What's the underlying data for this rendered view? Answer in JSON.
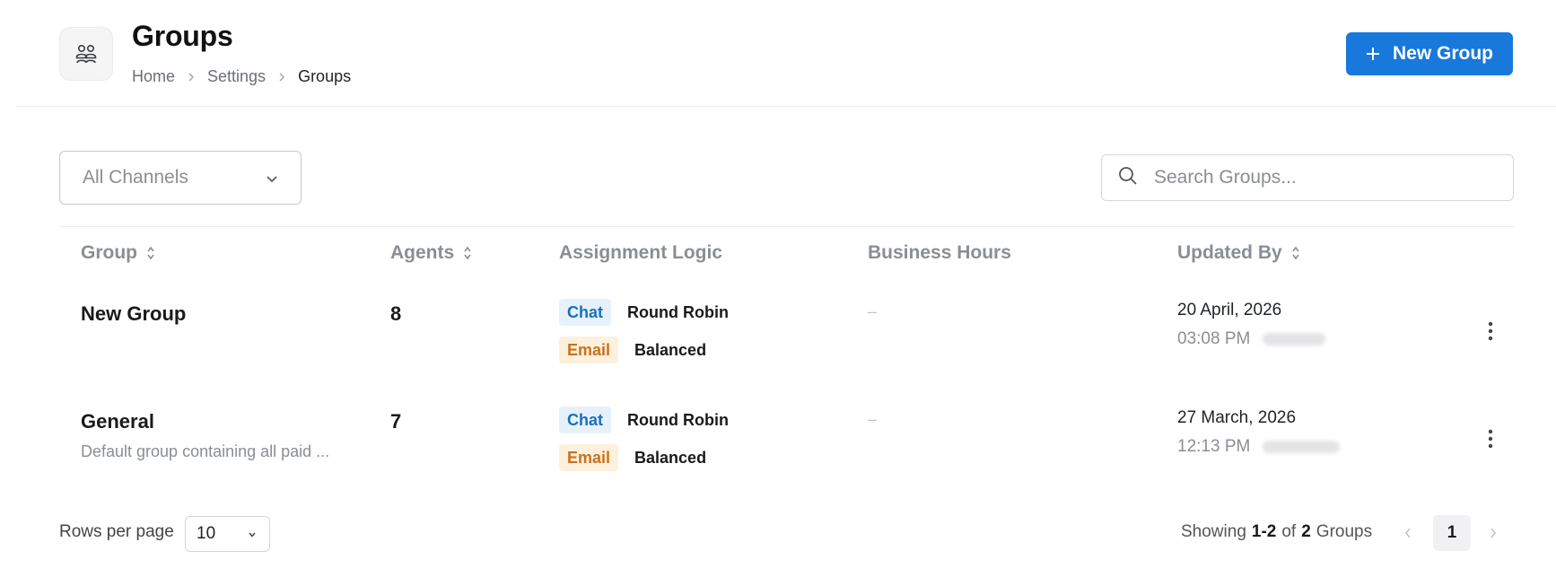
{
  "header": {
    "title": "Groups",
    "icon": "group-icon",
    "breadcrumb": [
      "Home",
      "Settings",
      "Groups"
    ],
    "new_button_label": "New Group"
  },
  "filters": {
    "channel_select_value": "All Channels",
    "search_placeholder": "Search Groups..."
  },
  "table": {
    "columns": [
      "Group",
      "Agents",
      "Assignment Logic",
      "Business Hours",
      "Updated By"
    ],
    "rows": [
      {
        "name": "New Group",
        "description": "",
        "agents": "8",
        "logic": [
          {
            "channel": "Chat",
            "strategy": "Round Robin"
          },
          {
            "channel": "Email",
            "strategy": "Balanced"
          }
        ],
        "business_hours": "–",
        "updated_date": "20 April, 2026",
        "updated_time": "03:08 PM"
      },
      {
        "name": "General",
        "description": "Default group containing all paid ...",
        "agents": "7",
        "logic": [
          {
            "channel": "Chat",
            "strategy": "Round Robin"
          },
          {
            "channel": "Email",
            "strategy": "Balanced"
          }
        ],
        "business_hours": "–",
        "updated_date": "27 March, 2026",
        "updated_time": "12:13 PM"
      }
    ]
  },
  "footer": {
    "rows_per_page_label": "Rows per page",
    "rows_per_page_value": "10",
    "showing_prefix": "Showing",
    "showing_range": "1-2",
    "showing_of": "of",
    "showing_total": "2",
    "showing_suffix": "Groups",
    "current_page": "1"
  },
  "colors": {
    "primary": "#1878db",
    "chat_tag_bg": "#e6f1fb",
    "chat_tag_text": "#1d6fb8",
    "email_tag_bg": "#fdf0dc",
    "email_tag_text": "#c8721c"
  }
}
